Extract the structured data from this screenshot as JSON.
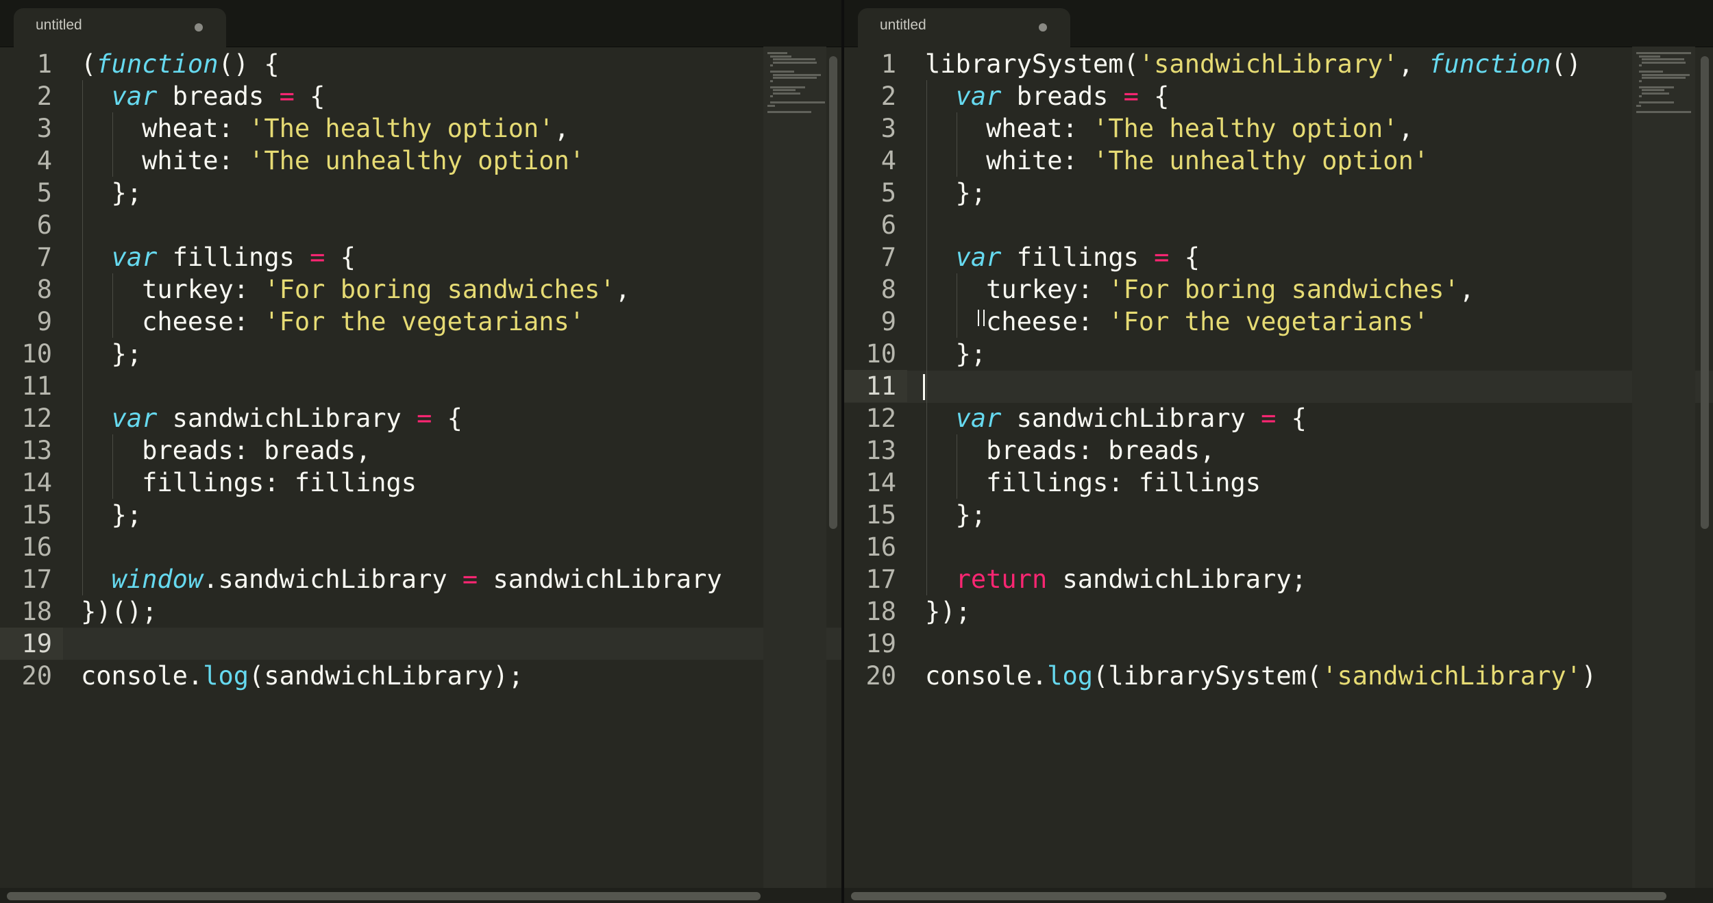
{
  "left": {
    "tab": {
      "title": "untitled"
    },
    "line_numbers": [
      "1",
      "2",
      "3",
      "4",
      "5",
      "6",
      "7",
      "8",
      "9",
      "10",
      "11",
      "12",
      "13",
      "14",
      "15",
      "16",
      "17",
      "18",
      "19",
      "20"
    ],
    "active_line": 19,
    "lines": [
      [
        {
          "t": "(",
          "c": "plain"
        },
        {
          "t": "function",
          "c": "kw-i"
        },
        {
          "t": "() {",
          "c": "plain"
        }
      ],
      [
        {
          "t": "  ",
          "c": "plain"
        },
        {
          "t": "var",
          "c": "kw-i"
        },
        {
          "t": " breads ",
          "c": "plain"
        },
        {
          "t": "=",
          "c": "op"
        },
        {
          "t": " {",
          "c": "plain"
        }
      ],
      [
        {
          "t": "    wheat: ",
          "c": "plain"
        },
        {
          "t": "'The healthy option'",
          "c": "str"
        },
        {
          "t": ",",
          "c": "plain"
        }
      ],
      [
        {
          "t": "    white: ",
          "c": "plain"
        },
        {
          "t": "'The unhealthy option'",
          "c": "str"
        }
      ],
      [
        {
          "t": "  };",
          "c": "plain"
        }
      ],
      [],
      [
        {
          "t": "  ",
          "c": "plain"
        },
        {
          "t": "var",
          "c": "kw-i"
        },
        {
          "t": " fillings ",
          "c": "plain"
        },
        {
          "t": "=",
          "c": "op"
        },
        {
          "t": " {",
          "c": "plain"
        }
      ],
      [
        {
          "t": "    turkey: ",
          "c": "plain"
        },
        {
          "t": "'For boring sandwiches'",
          "c": "str"
        },
        {
          "t": ",",
          "c": "plain"
        }
      ],
      [
        {
          "t": "    cheese: ",
          "c": "plain"
        },
        {
          "t": "'For the vegetarians'",
          "c": "str"
        }
      ],
      [
        {
          "t": "  };",
          "c": "plain"
        }
      ],
      [],
      [
        {
          "t": "  ",
          "c": "plain"
        },
        {
          "t": "var",
          "c": "kw-i"
        },
        {
          "t": " sandwichLibrary ",
          "c": "plain"
        },
        {
          "t": "=",
          "c": "op"
        },
        {
          "t": " {",
          "c": "plain"
        }
      ],
      [
        {
          "t": "    breads: breads,",
          "c": "plain"
        }
      ],
      [
        {
          "t": "    fillings: fillings",
          "c": "plain"
        }
      ],
      [
        {
          "t": "  };",
          "c": "plain"
        }
      ],
      [],
      [
        {
          "t": "  ",
          "c": "plain"
        },
        {
          "t": "window",
          "c": "kw-i"
        },
        {
          "t": ".sandwichLibrary ",
          "c": "plain"
        },
        {
          "t": "=",
          "c": "op"
        },
        {
          "t": " sandwichLibrary",
          "c": "plain"
        }
      ],
      [
        {
          "t": "})();",
          "c": "plain"
        }
      ],
      [],
      [
        {
          "t": "console.",
          "c": "plain"
        },
        {
          "t": "log",
          "c": "fn"
        },
        {
          "t": "(sandwichLibrary);",
          "c": "plain"
        }
      ]
    ]
  },
  "right": {
    "tab": {
      "title": "untitled"
    },
    "line_numbers": [
      "1",
      "2",
      "3",
      "4",
      "5",
      "6",
      "7",
      "8",
      "9",
      "10",
      "11",
      "12",
      "13",
      "14",
      "15",
      "16",
      "17",
      "18",
      "19",
      "20"
    ],
    "active_line": 11,
    "lines": [
      [
        {
          "t": "librarySystem(",
          "c": "plain"
        },
        {
          "t": "'sandwichLibrary'",
          "c": "str"
        },
        {
          "t": ", ",
          "c": "plain"
        },
        {
          "t": "function",
          "c": "kw-i"
        },
        {
          "t": "()",
          "c": "plain"
        }
      ],
      [
        {
          "t": "  ",
          "c": "plain"
        },
        {
          "t": "var",
          "c": "kw-i"
        },
        {
          "t": " breads ",
          "c": "plain"
        },
        {
          "t": "=",
          "c": "op"
        },
        {
          "t": " {",
          "c": "plain"
        }
      ],
      [
        {
          "t": "    wheat: ",
          "c": "plain"
        },
        {
          "t": "'The healthy option'",
          "c": "str"
        },
        {
          "t": ",",
          "c": "plain"
        }
      ],
      [
        {
          "t": "    white: ",
          "c": "plain"
        },
        {
          "t": "'The unhealthy option'",
          "c": "str"
        }
      ],
      [
        {
          "t": "  };",
          "c": "plain"
        }
      ],
      [],
      [
        {
          "t": "  ",
          "c": "plain"
        },
        {
          "t": "var",
          "c": "kw-i"
        },
        {
          "t": " fillings ",
          "c": "plain"
        },
        {
          "t": "=",
          "c": "op"
        },
        {
          "t": " {",
          "c": "plain"
        }
      ],
      [
        {
          "t": "    turkey: ",
          "c": "plain"
        },
        {
          "t": "'For boring sandwiches'",
          "c": "str"
        },
        {
          "t": ",",
          "c": "plain"
        }
      ],
      [
        {
          "t": "    cheese: ",
          "c": "plain"
        },
        {
          "t": "'For the vegetarians'",
          "c": "str"
        }
      ],
      [
        {
          "t": "  };",
          "c": "plain"
        }
      ],
      [],
      [
        {
          "t": "  ",
          "c": "plain"
        },
        {
          "t": "var",
          "c": "kw-i"
        },
        {
          "t": " sandwichLibrary ",
          "c": "plain"
        },
        {
          "t": "=",
          "c": "op"
        },
        {
          "t": " {",
          "c": "plain"
        }
      ],
      [
        {
          "t": "    breads: breads,",
          "c": "plain"
        }
      ],
      [
        {
          "t": "    fillings: fillings",
          "c": "plain"
        }
      ],
      [
        {
          "t": "  };",
          "c": "plain"
        }
      ],
      [],
      [
        {
          "t": "  ",
          "c": "plain"
        },
        {
          "t": "return",
          "c": "kw-r"
        },
        {
          "t": " sandwichLibrary;",
          "c": "plain"
        }
      ],
      [
        {
          "t": "});",
          "c": "plain"
        }
      ],
      [],
      [
        {
          "t": "console.",
          "c": "plain"
        },
        {
          "t": "log",
          "c": "fn"
        },
        {
          "t": "(librarySystem(",
          "c": "plain"
        },
        {
          "t": "'sandwichLibrary'",
          "c": "str"
        },
        {
          "t": ")",
          "c": "plain"
        }
      ]
    ]
  },
  "theme": {
    "background": "#272822",
    "keyword": "#66d9ef",
    "string": "#e6db74",
    "operator": "#f92672",
    "text": "#f8f8f2"
  }
}
